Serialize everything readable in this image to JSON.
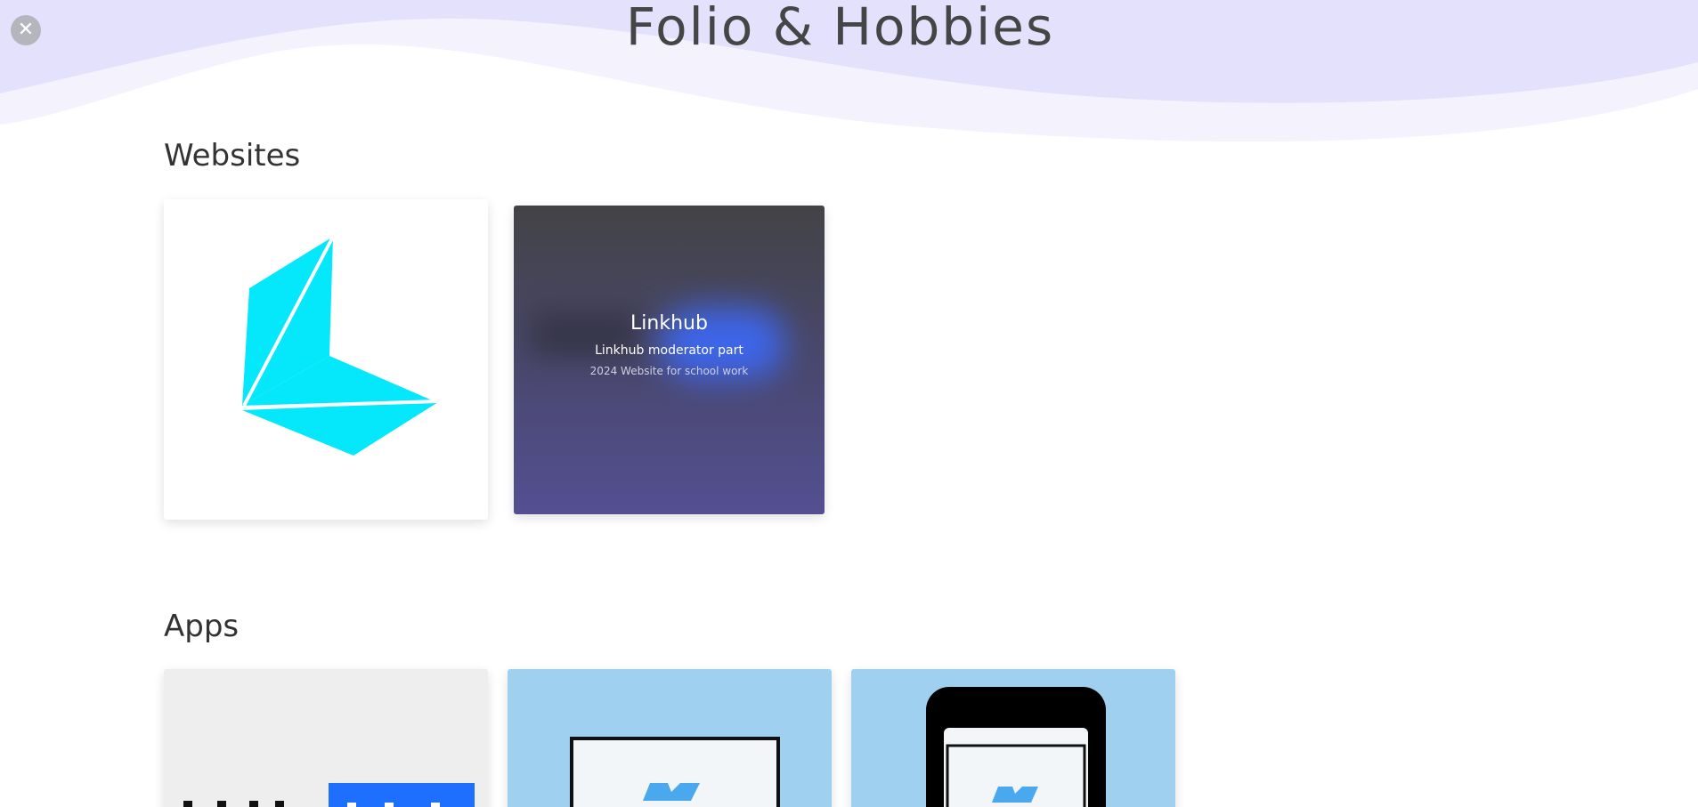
{
  "header": {
    "title": "Folio & Hobbies",
    "close_icon": "close-icon",
    "close_glyph": "✕"
  },
  "colors": {
    "wave_dark": "#e3e1fb",
    "wave_light": "#f1f0fd",
    "accent_cyan": "#05e8fb",
    "app_blue": "#a0d0f0",
    "app_gray": "#eeeeee",
    "brand_blue": "#1f6fff"
  },
  "sections": {
    "websites": {
      "title": "Websites",
      "cards": [
        {
          "icon": "linkhub-logo-icon"
        },
        {
          "title": "Linkhub",
          "subtitle": "Linkhub moderator part",
          "note": "2024 Website for school work"
        }
      ]
    },
    "apps": {
      "title": "Apps",
      "cards": [
        {
          "icon": "linkhub-wordmark-icon"
        },
        {
          "icon": "desktop-app-icon"
        },
        {
          "icon": "mobile-app-icon"
        }
      ]
    }
  }
}
